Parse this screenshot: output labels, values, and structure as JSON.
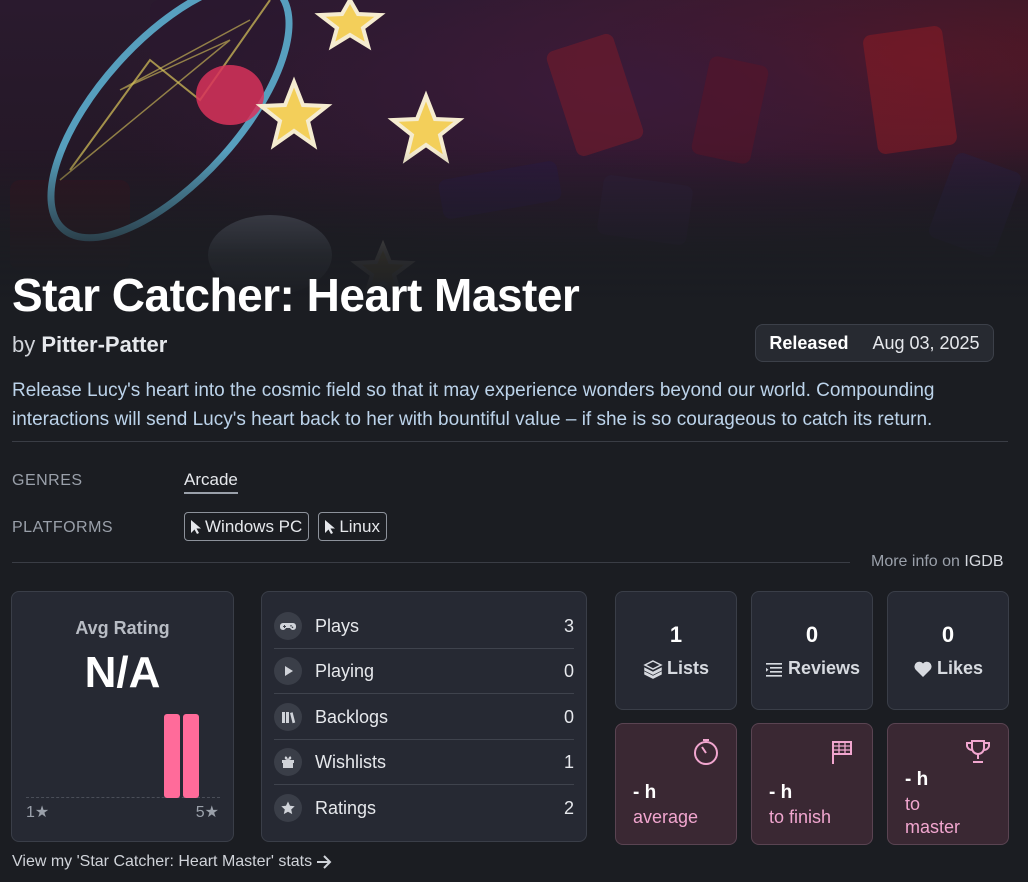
{
  "game": {
    "title": "Star Catcher: Heart Master",
    "by_label": "by",
    "developer": "Pitter-Patter",
    "released_label": "Released",
    "release_date": "Aug 03, 2025",
    "description": "Release Lucy's heart into the cosmic field so that it may experience wonders beyond our world. Compounding interactions will send Lucy's heart back to her with bountiful value – if she is so courageous to catch its return."
  },
  "meta": {
    "genres_label": "GENRES",
    "genres": [
      "Arcade"
    ],
    "platforms_label": "PLATFORMS",
    "platforms": [
      "Windows PC",
      "Linux"
    ],
    "more_info_prefix": "More info on",
    "more_info_source": "IGDB"
  },
  "rating": {
    "title": "Avg Rating",
    "value": "N/A",
    "min_label": "1★",
    "max_label": "5★",
    "distribution_color": "#ff6b9a",
    "distribution": [
      0,
      0,
      0,
      0,
      0,
      0,
      0,
      1,
      1,
      0
    ]
  },
  "stats": [
    {
      "label": "Plays",
      "value": "3",
      "icon": "gamepad-icon"
    },
    {
      "label": "Playing",
      "value": "0",
      "icon": "play-icon"
    },
    {
      "label": "Backlogs",
      "value": "0",
      "icon": "books-icon"
    },
    {
      "label": "Wishlists",
      "value": "1",
      "icon": "gift-icon"
    },
    {
      "label": "Ratings",
      "value": "2",
      "icon": "star-icon"
    }
  ],
  "counts": [
    {
      "value": "1",
      "label": "Lists",
      "icon": "layers-icon"
    },
    {
      "value": "0",
      "label": "Reviews",
      "icon": "list-lines-icon"
    },
    {
      "value": "0",
      "label": "Likes",
      "icon": "heart-icon"
    }
  ],
  "times": [
    {
      "value": "- h",
      "label": "average",
      "icon": "stopwatch-icon"
    },
    {
      "value": "- h",
      "label": "to finish",
      "icon": "flag-icon"
    },
    {
      "value": "- h",
      "label": "to master",
      "icon": "trophy-icon"
    }
  ],
  "footer": {
    "link": "View my 'Star Catcher: Heart Master' stats"
  },
  "colors": {
    "accent_pink": "#ff6b9a",
    "time_label": "#f1a6cf",
    "description": "#bcd3ea"
  }
}
